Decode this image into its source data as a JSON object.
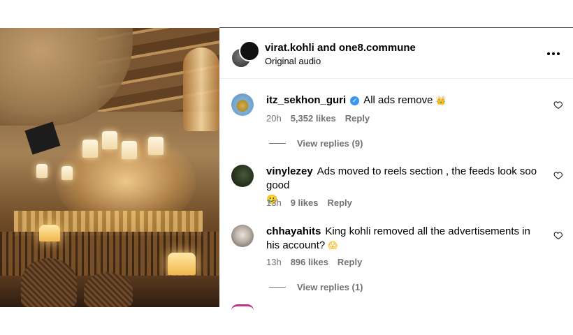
{
  "post": {
    "author": "virat.kohli and one8.commune",
    "audio": "Original audio"
  },
  "comments": [
    {
      "username": "itz_sekhon_guri",
      "verified": true,
      "text": "All ads remove",
      "emoji": "👑",
      "time": "20h",
      "likes": "5,352 likes",
      "reply": "Reply",
      "view_replies": "View replies (9)"
    },
    {
      "username": "vinylezey",
      "text": "Ads moved to reels section , the feeds look soo good",
      "emoji": "🥲",
      "time": "13h",
      "likes": "9 likes",
      "reply": "Reply"
    },
    {
      "username": "chhayahits",
      "text": "King kohli removed all the advertisements in his account?",
      "emoji": "😱",
      "time": "13h",
      "likes": "896 likes",
      "reply": "Reply",
      "view_replies": "View replies (1)"
    }
  ],
  "icons": {
    "more": "more-options-icon",
    "like": "heart-icon",
    "verified": "verified-badge-icon"
  },
  "colors": {
    "meta_text": "#737373",
    "verified_blue": "#3897f0"
  }
}
